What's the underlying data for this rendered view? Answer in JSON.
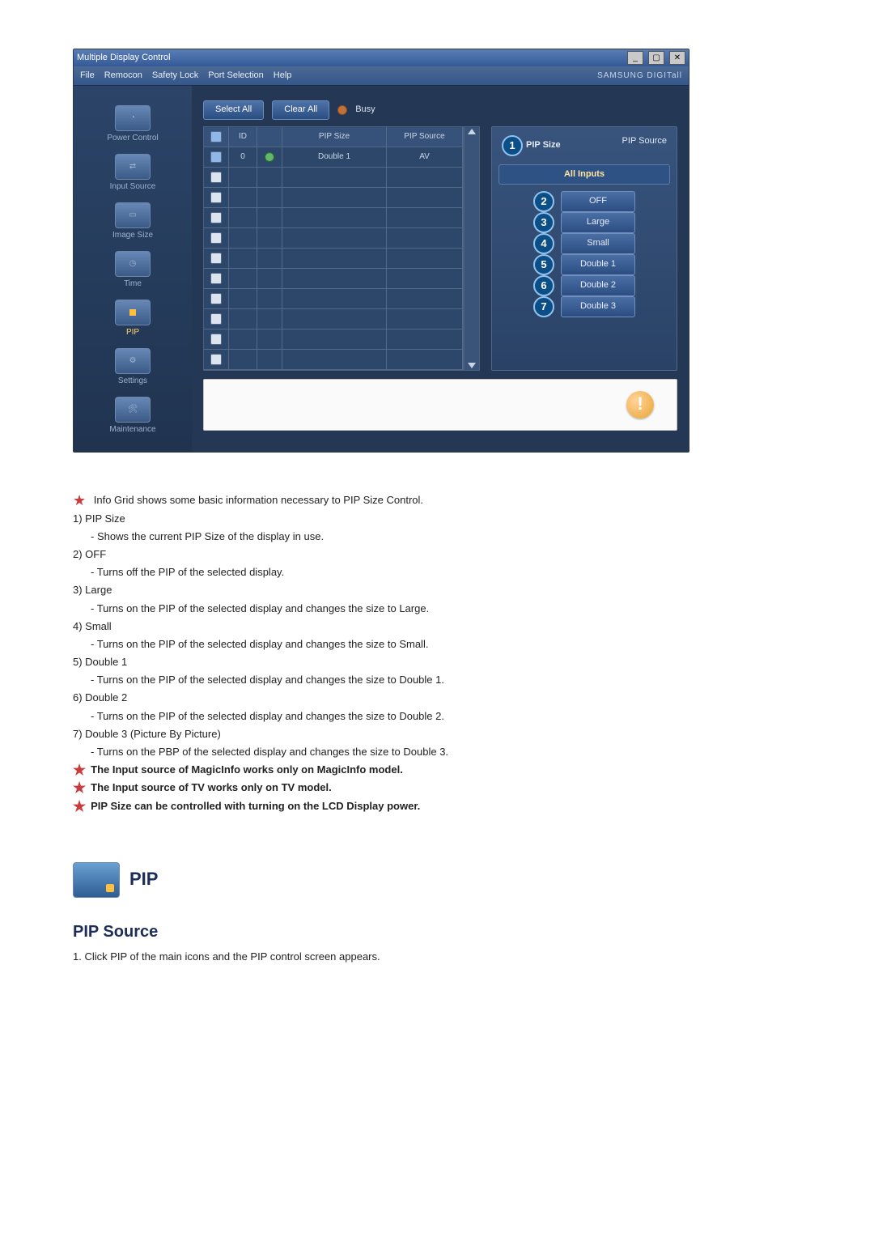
{
  "app": {
    "title": "Multiple Display Control",
    "brand": "SAMSUNG DIGITall",
    "menubar": [
      "File",
      "Remocon",
      "Safety Lock",
      "Port Selection",
      "Help"
    ],
    "sidebar": [
      {
        "label": "Power Control",
        "active": false
      },
      {
        "label": "Input Source",
        "active": false
      },
      {
        "label": "Image Size",
        "active": false
      },
      {
        "label": "Time",
        "active": false
      },
      {
        "label": "PIP",
        "active": true
      },
      {
        "label": "Settings",
        "active": false
      },
      {
        "label": "Maintenance",
        "active": false
      }
    ],
    "top_buttons": {
      "select_all": "Select All",
      "clear_all": "Clear All",
      "busy": "Busy"
    },
    "grid": {
      "headers": {
        "chk": "✓",
        "id": "ID",
        "dot": "",
        "pip_size": "PIP Size",
        "pip_source": "PIP Source"
      },
      "rows": [
        {
          "checked": true,
          "id": "0",
          "status": "on",
          "pip_size": "Double 1",
          "pip_source": "AV"
        },
        {
          "checked": false,
          "id": "",
          "status": "",
          "pip_size": "",
          "pip_source": ""
        },
        {
          "checked": false,
          "id": "",
          "status": "",
          "pip_size": "",
          "pip_source": ""
        },
        {
          "checked": false,
          "id": "",
          "status": "",
          "pip_size": "",
          "pip_source": ""
        },
        {
          "checked": false,
          "id": "",
          "status": "",
          "pip_size": "",
          "pip_source": ""
        },
        {
          "checked": false,
          "id": "",
          "status": "",
          "pip_size": "",
          "pip_source": ""
        },
        {
          "checked": false,
          "id": "",
          "status": "",
          "pip_size": "",
          "pip_source": ""
        },
        {
          "checked": false,
          "id": "",
          "status": "",
          "pip_size": "",
          "pip_source": ""
        },
        {
          "checked": false,
          "id": "",
          "status": "",
          "pip_size": "",
          "pip_source": ""
        },
        {
          "checked": false,
          "id": "",
          "status": "",
          "pip_size": "",
          "pip_source": ""
        },
        {
          "checked": false,
          "id": "",
          "status": "",
          "pip_size": "",
          "pip_source": ""
        }
      ]
    },
    "panel": {
      "header_left": "PIP Size",
      "header_left_num": "1",
      "header_right": "PIP Source",
      "all_inputs": "All Inputs",
      "options": [
        {
          "num": "2",
          "label": "OFF"
        },
        {
          "num": "3",
          "label": "Large"
        },
        {
          "num": "4",
          "label": "Small"
        },
        {
          "num": "5",
          "label": "Double 1"
        },
        {
          "num": "6",
          "label": "Double 2"
        },
        {
          "num": "7",
          "label": "Double 3"
        }
      ]
    }
  },
  "notes": {
    "intro": "Info Grid shows some basic information necessary to PIP Size Control.",
    "items": [
      {
        "head": "1)  PIP Size",
        "sub": "- Shows the current PIP Size of the display in use."
      },
      {
        "head": "2)  OFF",
        "sub": "- Turns off the PIP of the selected display."
      },
      {
        "head": "3)  Large",
        "sub": "- Turns on the PIP of the selected display and changes the size to Large."
      },
      {
        "head": "4)  Small",
        "sub": "- Turns on the PIP of the selected display and changes the size to Small."
      },
      {
        "head": "5)  Double 1",
        "sub": "- Turns on the PIP of the selected display and changes the size to Double 1."
      },
      {
        "head": "6)  Double 2",
        "sub": "- Turns on the PIP of the selected display and changes the size to Double 2."
      },
      {
        "head": "7)  Double 3 (Picture By Picture)",
        "sub": "- Turns on the PBP of the selected display and changes the size to Double 3."
      }
    ],
    "footnotes": [
      "The Input source of MagicInfo works only on MagicInfo model.",
      "The Input source of TV works only on TV model.",
      "PIP Size can be controlled with turning on the LCD Display power."
    ]
  },
  "section": {
    "pip_label": "PIP",
    "heading": "PIP Source",
    "step1": "1.  Click PIP of the main icons and the PIP control screen appears."
  }
}
